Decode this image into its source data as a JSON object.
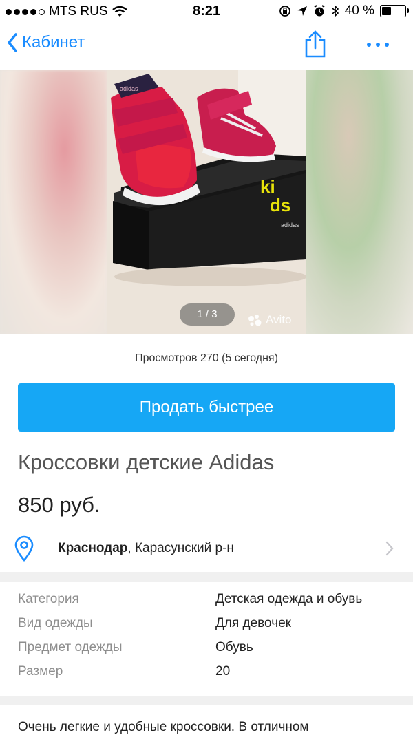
{
  "status_bar": {
    "carrier": "MTS RUS",
    "time": "8:21",
    "battery": "40 %",
    "battery_level": 0.4
  },
  "nav": {
    "back_label": "Кабинет"
  },
  "gallery": {
    "counter": "1 / 3",
    "watermark": "Avito"
  },
  "views_text": "Просмотров 270 (5 сегодня)",
  "sell_button": "Продать быстрее",
  "listing": {
    "title": "Кроссовки детские Adidas",
    "price": "850 руб."
  },
  "location": {
    "city": "Краснодар",
    "district": ", Карасунский р-н"
  },
  "params": [
    {
      "key": "Категория",
      "value": "Детская одежда и обувь"
    },
    {
      "key": "Вид одежды",
      "value": "Для девочек"
    },
    {
      "key": "Предмет одежды",
      "value": "Обувь"
    },
    {
      "key": "Размер",
      "value": "20"
    }
  ],
  "description": "Очень легкие и удобные кроссовки. В отличном",
  "colors": {
    "accent": "#1a8cff",
    "sell_button": "#16a7f5"
  }
}
